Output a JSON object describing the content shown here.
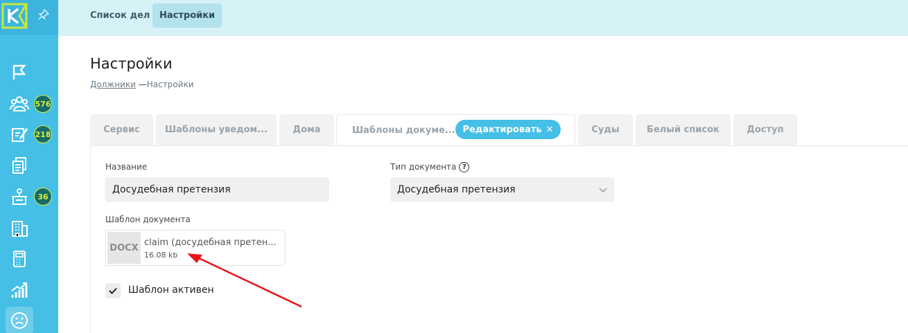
{
  "sidebar": {
    "badges": {
      "debtors": "576",
      "tasks": "218",
      "courts": "36"
    }
  },
  "topbar": {
    "tabs": [
      {
        "label": "Список дел"
      },
      {
        "label": "Настройки"
      }
    ]
  },
  "page": {
    "title": "Настройки",
    "breadcrumb": {
      "root": "Должники",
      "separator": "—",
      "current": "Настройки"
    }
  },
  "tabs": [
    {
      "label": "Сервис"
    },
    {
      "label": "Шаблоны уведом..."
    },
    {
      "label": "Дома"
    },
    {
      "label": "Шаблоны докуме..."
    },
    {
      "label": "Суды"
    },
    {
      "label": "Белый список"
    },
    {
      "label": "Доступ"
    }
  ],
  "edit_pill": {
    "label": "Редактировать",
    "close": "✕"
  },
  "form": {
    "name_label": "Название",
    "name_value": "Досудебная претензия",
    "doc_type_label": "Тип документа",
    "doc_type_help": "?",
    "doc_type_value": "Досудебная претензия",
    "template_label": "Шаблон документа",
    "file": {
      "type": "DOCX",
      "name": "claim (досудебная претен...",
      "size": "16.08 kb"
    },
    "active_label": "Шаблон активен",
    "active_checked": true
  },
  "colors": {
    "sidebar": "#45bfe6",
    "topbar": "#d6f2f7",
    "accent": "#45bfe6",
    "badge": "#176b6a",
    "badge_text": "#d6f03a",
    "annotation_arrow": "#e8141a"
  }
}
